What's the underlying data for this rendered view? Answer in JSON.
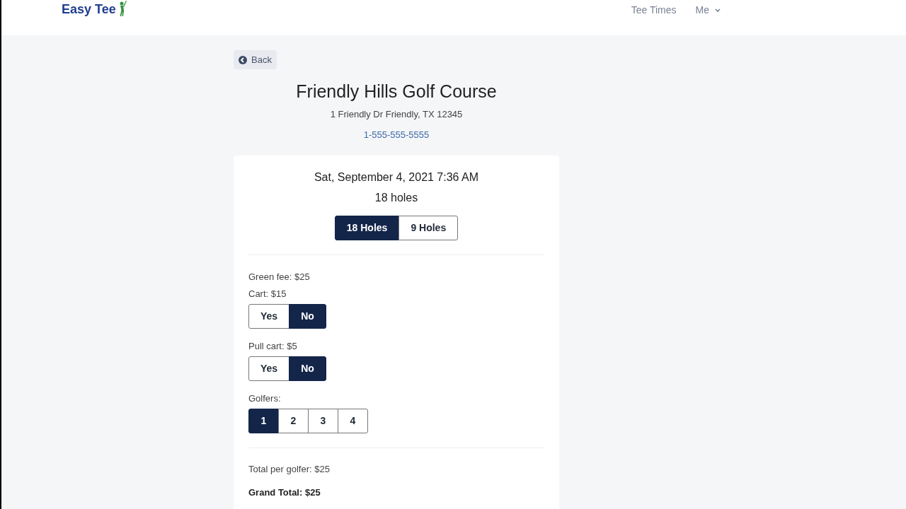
{
  "header": {
    "logo": "Easy Tee",
    "nav": [
      {
        "label": "Tee Times",
        "kind": "link"
      },
      {
        "label": "Me",
        "kind": "dropdown"
      }
    ]
  },
  "back_button": "Back",
  "course": {
    "name": "Friendly Hills Golf Course",
    "address": "1 Friendly Dr Friendly, TX 12345",
    "phone": "1-555-555-5555"
  },
  "booking": {
    "datetime": "Sat, September 4, 2021 7:36 AM",
    "holes_label": "18 holes",
    "holes_options": [
      {
        "label": "18 Holes",
        "selected": true
      },
      {
        "label": "9 Holes",
        "selected": false
      }
    ],
    "green_fee": "Green fee: $25",
    "options": [
      {
        "label": "Cart: $15",
        "choices": [
          {
            "label": "Yes",
            "selected": false
          },
          {
            "label": "No",
            "selected": true
          }
        ]
      },
      {
        "label": "Pull cart: $5",
        "choices": [
          {
            "label": "Yes",
            "selected": false
          },
          {
            "label": "No",
            "selected": true
          }
        ]
      },
      {
        "label": "Golfers:",
        "choices": [
          {
            "label": "1",
            "selected": true
          },
          {
            "label": "2",
            "selected": false
          },
          {
            "label": "3",
            "selected": false
          },
          {
            "label": "4",
            "selected": false
          }
        ]
      }
    ],
    "total_per_golfer": "Total per golfer: $25",
    "grand_total": "Grand Total: $25"
  }
}
